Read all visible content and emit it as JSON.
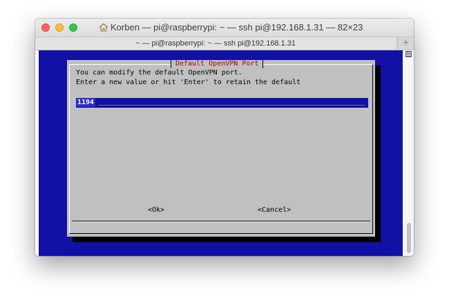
{
  "window": {
    "title": "Korben — pi@raspberrypi: ~ — ssh pi@192.168.1.31 — 82×23",
    "tab_title": "~ — pi@raspberrypi: ~ — ssh pi@192.168.1.31",
    "new_tab_symbol": "+"
  },
  "dialog": {
    "title": "Default OpenVPN Port",
    "line1": "You can modify the default OpenVPN port.",
    "line2": "Enter a new value or hit 'Enter' to retain the default",
    "input_value": "1194",
    "ok_label": "<Ok>",
    "cancel_label": "<Cancel>"
  },
  "colors": {
    "terminal_background": "#1111a6",
    "dialog_background": "#c0c0c0",
    "title_color": "#b00000",
    "input_highlight": "#2a2ad8"
  },
  "icons": {
    "title_icon": "home-icon",
    "close": "close-window-icon",
    "minimize": "minimize-window-icon",
    "maximize": "zoom-window-icon",
    "scroll_menu": "scrollbar-menu-icon"
  }
}
